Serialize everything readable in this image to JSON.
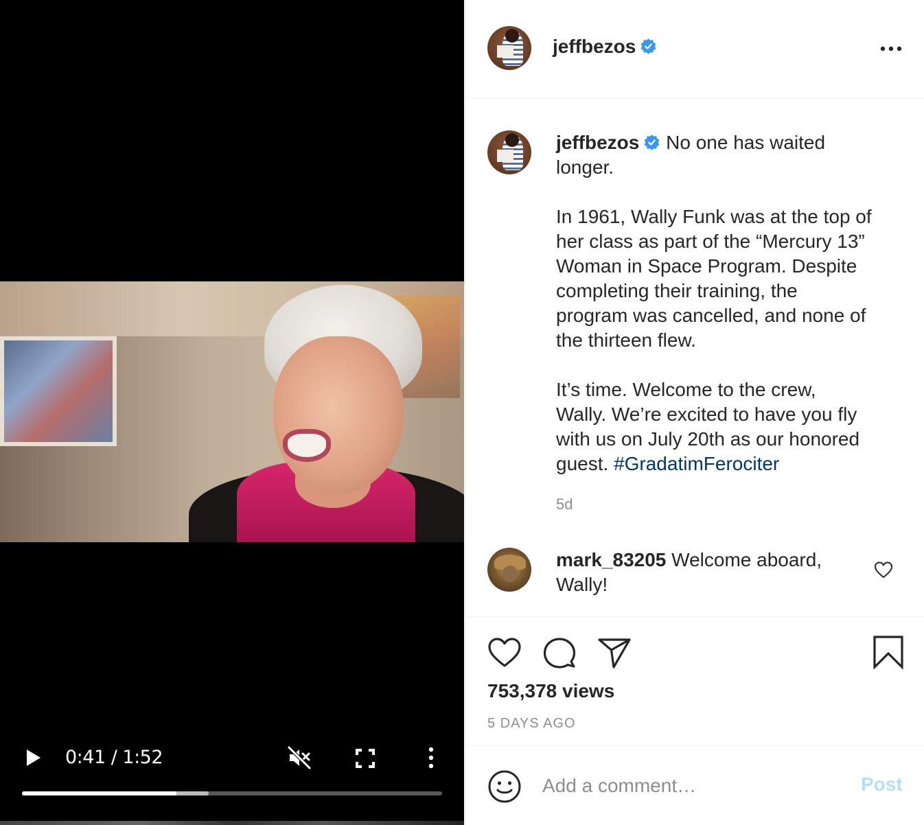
{
  "video": {
    "current_time": "0:41",
    "duration": "1:52",
    "time_separator": " / ",
    "progress_fraction": 0.368,
    "buffered_fraction": 0.444,
    "muted": true
  },
  "post": {
    "author": "jeffbezos",
    "verified": true,
    "caption_lines": [
      "No one has waited",
      "longer.",
      "",
      "In 1961, Wally Funk was at the top of",
      "her class as part of the “Mercury 13”",
      "Woman in Space Program. Despite",
      "completing their training, the",
      "program was cancelled, and none of",
      "the thirteen flew.",
      "",
      "It’s time. Welcome to the crew,",
      "Wally. We’re excited to have you fly",
      "with us on July 20th as our honored",
      "guest. "
    ],
    "hashtag": "#GradatimFerociter",
    "caption_age": "5d",
    "views": "753,378 views",
    "posted_ago": "5 DAYS AGO"
  },
  "comments": [
    {
      "username": "mark_83205",
      "text_line1": "Welcome aboard,",
      "text_line2": "Wally!"
    }
  ],
  "comment_box": {
    "placeholder": "Add a comment…",
    "post_label": "Post"
  },
  "colors": {
    "verified_blue": "#3897f0",
    "hashtag": "#00376b",
    "post_button_disabled": "#b2dffc",
    "muted_text": "#8e8e8e"
  },
  "icons": [
    "play-icon",
    "muted-speaker-icon",
    "fullscreen-icon",
    "vertical-ellipsis-icon",
    "verified-badge-icon",
    "horizontal-ellipsis-icon",
    "heart-icon",
    "comment-bubble-icon",
    "paper-plane-icon",
    "bookmark-icon",
    "smiley-icon"
  ]
}
